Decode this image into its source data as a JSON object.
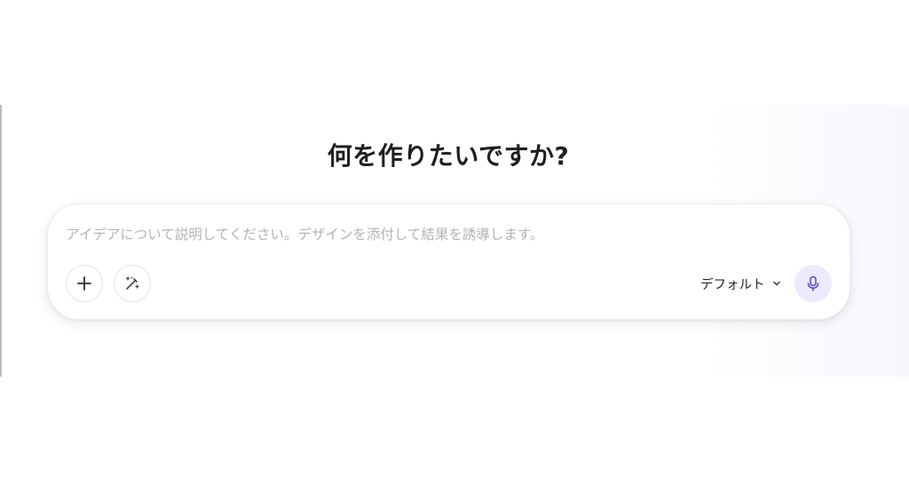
{
  "heading": "何を作りたいですか?",
  "prompt": {
    "value": "",
    "placeholder": "アイデアについて説明してください。デザインを添付して結果を誘導します。"
  },
  "toolbar": {
    "add_icon": "plus-icon",
    "enhance_icon": "magic-wand-icon",
    "model_label": "デフォルト",
    "model_dropdown_icon": "chevron-down-icon",
    "mic_icon": "microphone-icon"
  },
  "colors": {
    "heading_text": "#1f1f1f",
    "placeholder_text": "#b3b3b3",
    "mic_button_bg": "#ecebfb",
    "mic_icon": "#5b4fd6"
  }
}
